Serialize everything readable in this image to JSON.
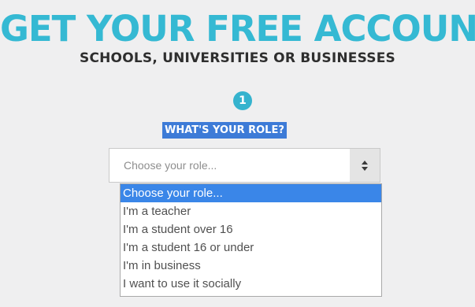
{
  "header": {
    "title": "GET YOUR FREE ACCOUNT",
    "subtitle": "SCHOOLS, UNIVERSITIES OR BUSINESSES"
  },
  "step": {
    "number": "1",
    "question": "WHAT'S YOUR ROLE?"
  },
  "role_select": {
    "current_value": "Choose your role...",
    "options": [
      {
        "label": "Choose your role...",
        "highlighted": true
      },
      {
        "label": "I'm a teacher",
        "highlighted": false
      },
      {
        "label": "I'm a student over 16",
        "highlighted": false
      },
      {
        "label": "I'm a student 16 or under",
        "highlighted": false
      },
      {
        "label": "I'm in business",
        "highlighted": false
      },
      {
        "label": "I want to use it socially",
        "highlighted": false
      }
    ]
  },
  "colors": {
    "brand_cyan": "#35b9d3",
    "highlight_blue": "#3a86e8",
    "question_highlight": "#3d7bd7",
    "background": "#efeff0"
  }
}
